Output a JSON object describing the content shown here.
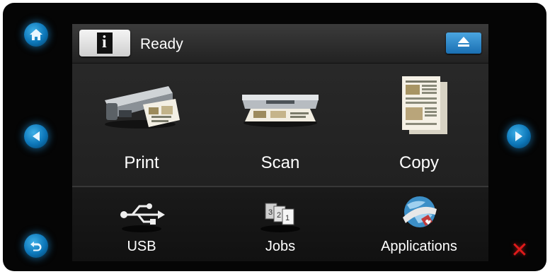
{
  "status": {
    "text": "Ready"
  },
  "main_tiles": [
    {
      "label": "Print"
    },
    {
      "label": "Scan"
    },
    {
      "label": "Copy"
    }
  ],
  "bottom_tiles": [
    {
      "label": "USB"
    },
    {
      "label": "Jobs"
    },
    {
      "label": "Applications"
    }
  ],
  "icons": {
    "home": "home-icon",
    "left": "left-arrow-icon",
    "back": "back-icon",
    "right": "right-arrow-icon",
    "cancel": "cancel-icon",
    "info": "info-icon",
    "eject": "eject-icon"
  },
  "colors": {
    "accent": "#1a7fc4",
    "cancel": "#e01a1a"
  }
}
